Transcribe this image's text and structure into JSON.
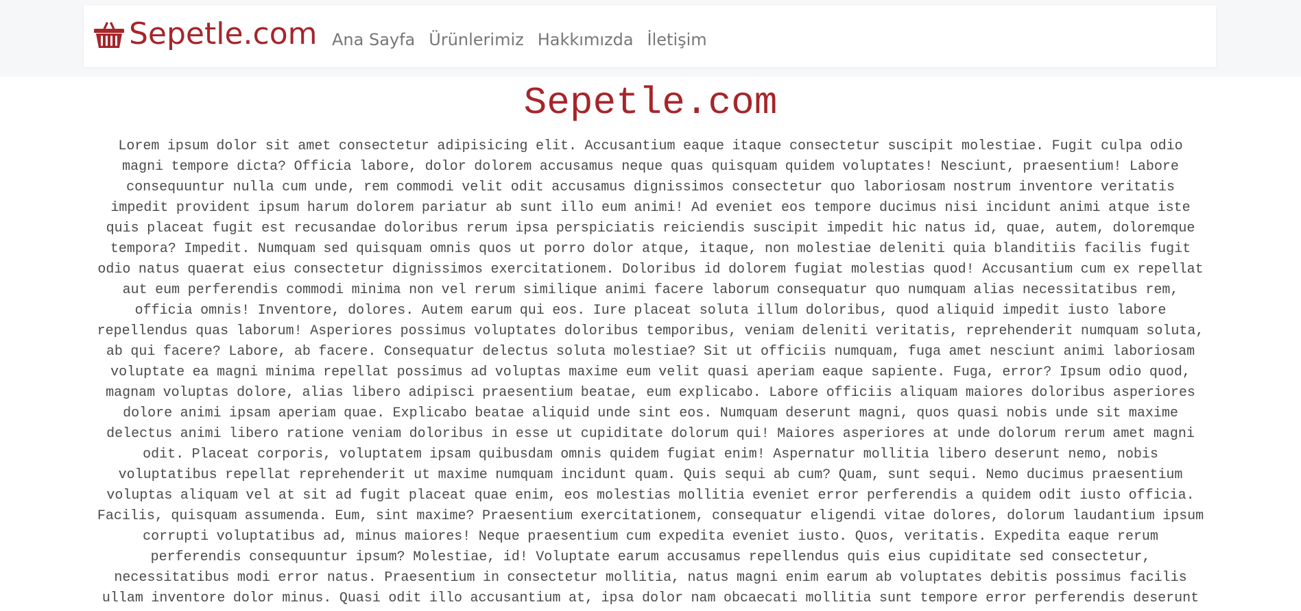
{
  "header": {
    "brand": {
      "icon": "basket-icon",
      "name": "Sepetle.com",
      "color": "#a5262b"
    },
    "nav_links": [
      {
        "label": "Ana Sayfa"
      },
      {
        "label": "Ürünlerimiz"
      },
      {
        "label": "Hakkımızda"
      },
      {
        "label": "İletişim"
      }
    ]
  },
  "main": {
    "title": "Sepetle.com",
    "paragraph": "Lorem ipsum dolor sit amet consectetur adipisicing elit. Accusantium eaque itaque consectetur suscipit molestiae. Fugit culpa odio magni tempore dicta? Officia labore, dolor dolorem accusamus neque quas quisquam quidem voluptates! Nesciunt, praesentium! Labore consequuntur nulla cum unde, rem commodi velit odit accusamus dignissimos consectetur quo laboriosam nostrum inventore veritatis impedit provident ipsum harum dolorem pariatur ab sunt illo eum animi! Ad eveniet eos tempore ducimus nisi incidunt animi atque iste quis placeat fugit est recusandae doloribus rerum ipsa perspiciatis reiciendis suscipit impedit hic natus id, quae, autem, doloremque tempora? Impedit. Numquam sed quisquam omnis quos ut porro dolor atque, itaque, non molestiae deleniti quia blanditiis facilis fugit odio natus quaerat eius consectetur dignissimos exercitationem. Doloribus id dolorem fugiat molestias quod! Accusantium cum ex repellat aut eum perferendis commodi minima non vel rerum similique animi facere laborum consequatur quo numquam alias necessitatibus rem, officia omnis! Inventore, dolores. Autem earum qui eos. Iure placeat soluta illum doloribus, quod aliquid impedit iusto labore repellendus quas laborum! Asperiores possimus voluptates doloribus temporibus, veniam deleniti veritatis, reprehenderit numquam soluta, ab qui facere? Labore, ab facere. Consequatur delectus soluta molestiae? Sit ut officiis numquam, fuga amet nesciunt animi laboriosam voluptate ea magni minima repellat possimus ad voluptas maxime eum velit quasi aperiam eaque sapiente. Fuga, error? Ipsum odio quod, magnam voluptas dolore, alias libero adipisci praesentium beatae, eum explicabo. Labore officiis aliquam maiores doloribus asperiores dolore animi ipsam aperiam quae. Explicabo beatae aliquid unde sint eos. Numquam deserunt magni, quos quasi nobis unde sit maxime delectus animi libero ratione veniam doloribus in esse ut cupiditate dolorum qui! Maiores asperiores at unde dolorum rerum amet magni odit. Placeat corporis, voluptatem ipsam quibusdam omnis quidem fugiat enim! Aspernatur mollitia libero deserunt nemo, nobis voluptatibus repellat reprehenderit ut maxime numquam incidunt quam. Quis sequi ab cum? Quam, sunt sequi. Nemo ducimus praesentium voluptas aliquam vel at sit ad fugit placeat quae enim, eos molestias mollitia eveniet error perferendis a quidem odit iusto officia. Facilis, quisquam assumenda. Eum, sint maxime? Praesentium exercitationem, consequatur eligendi vitae dolores, dolorum laudantium ipsum corrupti voluptatibus ad, minus maiores! Neque praesentium cum expedita eveniet iusto. Quos, veritatis. Expedita eaque rerum perferendis consequuntur ipsum? Molestiae, id! Voluptate earum accusamus repellendus quis eius cupiditate sed consectetur, necessitatibus modi error natus. Praesentium in consectetur mollitia, natus magni enim earum ab voluptates debitis possimus facilis ullam inventore dolor minus. Quasi odit illo accusantium at, ipsa dolor nam obcaecati mollitia sunt tempore error perferendis deserunt"
  }
}
